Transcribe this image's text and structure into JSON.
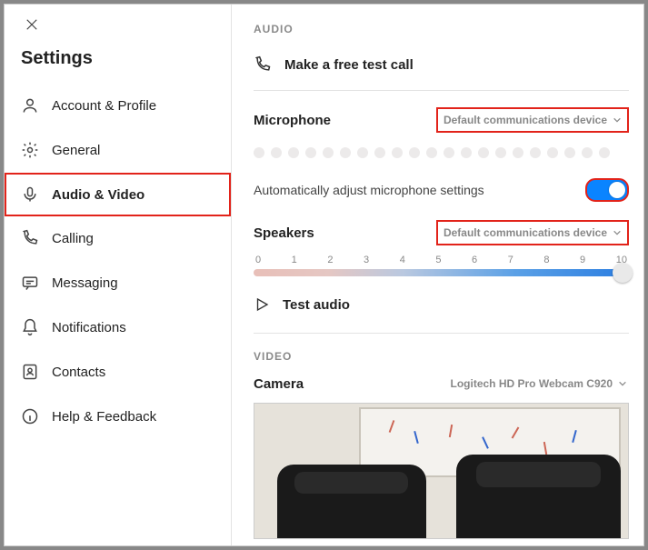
{
  "header": {
    "title": "Settings"
  },
  "sidebar": {
    "items": [
      {
        "label": "Account & Profile"
      },
      {
        "label": "General"
      },
      {
        "label": "Audio & Video"
      },
      {
        "label": "Calling"
      },
      {
        "label": "Messaging"
      },
      {
        "label": "Notifications"
      },
      {
        "label": "Contacts"
      },
      {
        "label": "Help & Feedback"
      }
    ],
    "activeIndex": 2
  },
  "audio": {
    "section_label": "AUDIO",
    "test_call_label": "Make a free test call",
    "microphone_label": "Microphone",
    "microphone_selected": "Default communications device",
    "auto_adjust_label": "Automatically adjust microphone settings",
    "auto_adjust_on": true,
    "speakers_label": "Speakers",
    "speakers_selected": "Default communications device",
    "speaker_scale": [
      "0",
      "1",
      "2",
      "3",
      "4",
      "5",
      "6",
      "7",
      "8",
      "9",
      "10"
    ],
    "speaker_value": 10,
    "test_audio_label": "Test audio"
  },
  "video": {
    "section_label": "VIDEO",
    "camera_label": "Camera",
    "camera_selected": "Logitech HD Pro Webcam C920"
  }
}
